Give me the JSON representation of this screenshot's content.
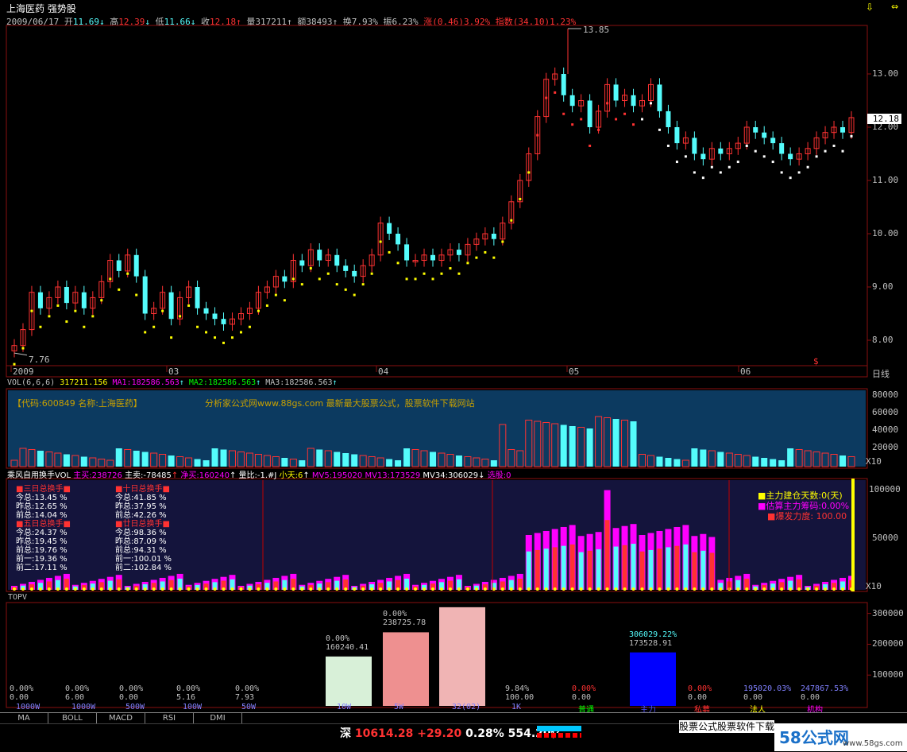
{
  "header": {
    "stock_name": "上海医药",
    "indicator": "强势股"
  },
  "quote": {
    "date": "2009/06/17",
    "open_label": "开",
    "open": "11.69",
    "high_label": "高",
    "high": "12.39",
    "low_label": "低",
    "low": "11.66",
    "close_label": "收",
    "close": "12.18",
    "volume_label": "量",
    "volume": "317211",
    "amount_label": "额",
    "amount": "38493",
    "turnover_label": "换",
    "turnover": "7.93%",
    "amplitude_label": "振",
    "amplitude": "6.23%",
    "change_label": "涨",
    "change": "(0.46)3.92%",
    "index_label": "指数",
    "index_change": "(34.10)1.23%"
  },
  "kline": {
    "price_labels": [
      "13.00",
      "12.00",
      "11.00",
      "10.00",
      "9.00",
      "8.00"
    ],
    "price_values": [
      13,
      12,
      11,
      10,
      9,
      8
    ],
    "current_price_tag": "12.18",
    "high_annot": "13.85",
    "low_annot": "7.76",
    "date_ticks": [
      "2009",
      "03",
      "04",
      "05",
      "06"
    ],
    "period": "日线",
    "s_marker": "$"
  },
  "volume_pane": {
    "header": "VOL(6,6,6)",
    "vol": "317211.156",
    "ma1": "MA1:182586.563",
    "ma2": "MA2:182586.563",
    "ma3": "MA3:182586.563",
    "code_text": "【代码:600849 名称:上海医药】",
    "ad_text": "分析家公式网www.88gs.com 最新最大股票公式，股票软件下载网站",
    "axis": [
      "80000",
      "60000",
      "40000",
      "20000",
      "X10"
    ]
  },
  "turnover_pane": {
    "header": "乘风自用换手VOL",
    "main_buy": "主买:238726",
    "main_sell": "主卖:-78485",
    "net_buy": "净买:160240",
    "vol_ratio": "量比:-1.#J",
    "small_sky": "小天:6",
    "mv5": "MV5:195020",
    "mv13": "MV13:173529",
    "mv34": "MV34:306029",
    "select": "选股:0",
    "left_title": "三日总换手",
    "left_lines": [
      "今总:13.45 %",
      "昨总:12.65 %",
      "前总:14.04 %"
    ],
    "left_title2": "五日总换手",
    "left_lines2": [
      "今总:24.37 %",
      "昨总:19.45 %",
      "前总:19.76 %",
      "前一:19.36 %",
      "前二:17.11 %"
    ],
    "right_title": "十日总换手",
    "right_lines": [
      "今总:41.85 %",
      "昨总:37.95 %",
      "前总:42.26 %"
    ],
    "right_title2": "廿日总换手",
    "right_lines2": [
      "今总:98.36 %",
      "昨总:87.09 %",
      "前总:94.31 %",
      "前一:100.01 %",
      "前二:102.84 %"
    ],
    "legend": [
      "主力建仓天数:0(天)",
      "估算主力筹码:0.00%",
      "爆发力度: 100.00"
    ],
    "axis": [
      "100000",
      "50000",
      "X10"
    ]
  },
  "topv": {
    "title": "TOPV",
    "axis": [
      "300000",
      "200000",
      "100000"
    ],
    "columns": [
      {
        "pct": "0.00%",
        "val": "0.00",
        "label": "1000W"
      },
      {
        "pct": "0.00%",
        "val": "6.00",
        "label": "1000W"
      },
      {
        "pct": "0.00%",
        "val": "0.00",
        "label": "500W"
      },
      {
        "pct": "0.00%",
        "val": "5.16",
        "label": "100W"
      },
      {
        "pct": "0.00%",
        "val": "7.93",
        "label": "50W"
      },
      {
        "pct": "0.00%",
        "val": "160240.41",
        "label": "10W"
      },
      {
        "pct": "0.00%",
        "val": "238725.78",
        "label": "5W"
      },
      {
        "pct": "",
        "val": "",
        "label": "32(02)"
      },
      {
        "pct": "9.84%",
        "val": "100.00",
        "label": "1K"
      },
      {
        "pct": "0.00%",
        "val": "0.00",
        "label": "普通"
      },
      {
        "pct": "306029.22%",
        "val": "173528.91",
        "label": "主力"
      },
      {
        "pct": "0.00%",
        "val": "0.00",
        "label": "私募"
      },
      {
        "pct": "195020.03%",
        "val": "0.00",
        "label": "法人"
      },
      {
        "pct": "247867.53%",
        "val": "0.00",
        "label": "机构"
      }
    ],
    "bar_values": [
      160240,
      238726,
      320000,
      173529
    ]
  },
  "tabs": [
    "MA",
    "BOLL",
    "MACD",
    "RSI",
    "DMI"
  ],
  "status": {
    "market": "深",
    "index_value": "10614.28",
    "index_change": "+29.20",
    "index_pct": "0.28%",
    "turnover": "554.20亿",
    "ad": "股票公式股票软件下载",
    "watermark_main": "58公式网",
    "watermark_url": "www.58gs.com"
  },
  "colors": {
    "up": "#ff3232",
    "down": "#54fcfc",
    "axis_red": "#8a1010",
    "yellow": "#ffff00",
    "magenta": "#ff00ff",
    "green": "#00ff00"
  }
}
